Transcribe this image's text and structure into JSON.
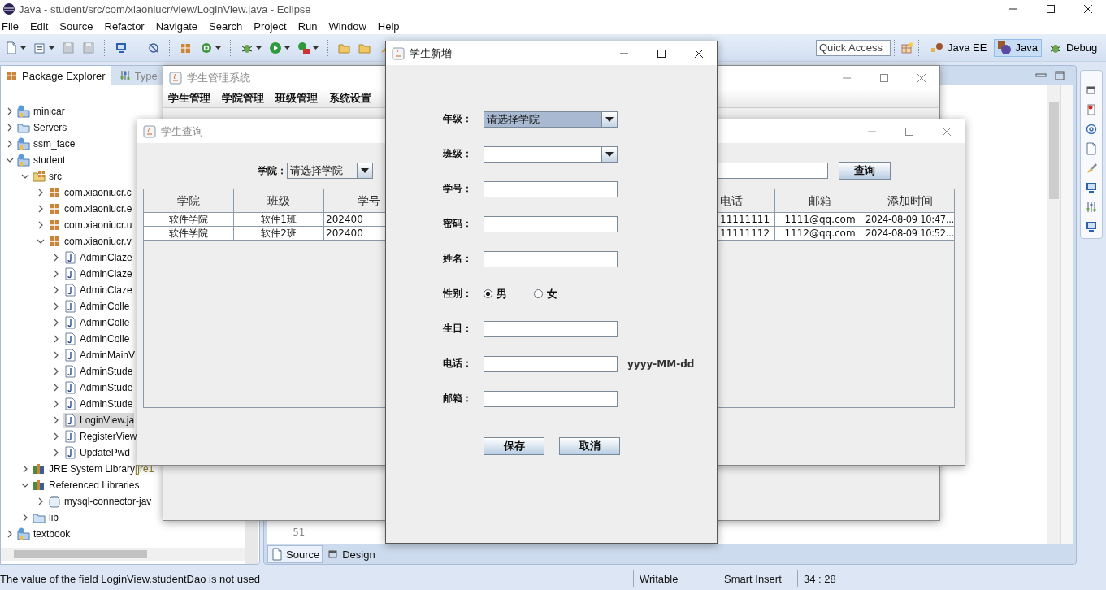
{
  "window": {
    "title": "Java - student/src/com/xiaoniucr/view/LoginView.java - Eclipse"
  },
  "menu": [
    "File",
    "Edit",
    "Source",
    "Refactor",
    "Navigate",
    "Search",
    "Project",
    "Run",
    "Window",
    "Help"
  ],
  "toolbar": {
    "quick_access": {
      "placeholder": "Quick Access"
    },
    "perspectives": [
      {
        "label": "Java EE",
        "selected": false
      },
      {
        "label": "Java",
        "selected": true
      },
      {
        "label": "Debug",
        "selected": false
      }
    ]
  },
  "views": {
    "tabs": [
      {
        "label": "Package Explorer",
        "selected": true
      },
      {
        "label": "Type",
        "selected": false
      }
    ],
    "tree": [
      {
        "label": "minicar",
        "kind": "project",
        "expanded": false,
        "selected": false
      },
      {
        "label": "Servers",
        "kind": "folder",
        "expanded": false,
        "selected": false
      },
      {
        "label": "ssm_face",
        "kind": "project",
        "expanded": false,
        "selected": false
      },
      {
        "label": "student",
        "kind": "project",
        "expanded": true,
        "selected": false,
        "children": [
          {
            "label": "src",
            "kind": "source-folder",
            "expanded": true,
            "selected": false,
            "children": [
              {
                "label": "com.xiaoniucr.c",
                "kind": "package",
                "expanded": false,
                "selected": false
              },
              {
                "label": "com.xiaoniucr.e",
                "kind": "package",
                "expanded": false,
                "selected": false
              },
              {
                "label": "com.xiaoniucr.u",
                "kind": "package",
                "expanded": false,
                "selected": false
              },
              {
                "label": "com.xiaoniucr.v",
                "kind": "package",
                "expanded": true,
                "selected": false,
                "children": [
                  {
                    "label": "AdminClaze",
                    "kind": "java-file",
                    "expanded": false,
                    "selected": false
                  },
                  {
                    "label": "AdminClaze",
                    "kind": "java-file",
                    "expanded": false,
                    "selected": false
                  },
                  {
                    "label": "AdminClaze",
                    "kind": "java-file",
                    "expanded": false,
                    "selected": false
                  },
                  {
                    "label": "AdminColle",
                    "kind": "java-file",
                    "expanded": false,
                    "selected": false
                  },
                  {
                    "label": "AdminColle",
                    "kind": "java-file",
                    "expanded": false,
                    "selected": false
                  },
                  {
                    "label": "AdminColle",
                    "kind": "java-file",
                    "expanded": false,
                    "selected": false
                  },
                  {
                    "label": "AdminMainV",
                    "kind": "java-file",
                    "expanded": false,
                    "selected": false
                  },
                  {
                    "label": "AdminStude",
                    "kind": "java-file",
                    "expanded": false,
                    "selected": false
                  },
                  {
                    "label": "AdminStude",
                    "kind": "java-file",
                    "expanded": false,
                    "selected": false
                  },
                  {
                    "label": "AdminStude",
                    "kind": "java-file",
                    "expanded": false,
                    "selected": false
                  },
                  {
                    "label": "LoginView.ja",
                    "kind": "java-file",
                    "expanded": false,
                    "selected": true
                  },
                  {
                    "label": "RegisterView",
                    "kind": "java-file",
                    "expanded": false,
                    "selected": false
                  },
                  {
                    "label": "UpdatePwd",
                    "kind": "java-file",
                    "expanded": false,
                    "selected": false
                  }
                ]
              }
            ]
          },
          {
            "label": "JRE System Library",
            "decoration": "[jre1",
            "kind": "library",
            "expanded": false,
            "selected": false
          },
          {
            "label": "Referenced Libraries",
            "kind": "library",
            "expanded": true,
            "selected": false,
            "children": [
              {
                "label": "mysql-connector-jav",
                "kind": "jar",
                "expanded": false,
                "selected": false
              }
            ]
          },
          {
            "label": "lib",
            "kind": "folder",
            "expanded": false,
            "selected": false
          }
        ]
      },
      {
        "label": "textbook",
        "kind": "project",
        "expanded": false,
        "selected": false
      }
    ]
  },
  "editor": {
    "line_number": "51",
    "tabs": [
      {
        "label": "Source",
        "selected": true
      },
      {
        "label": "Design",
        "selected": false
      }
    ]
  },
  "status_bar": {
    "message": "The value of the field LoginView.studentDao is not used",
    "mode": "Writable",
    "insert_mode": "Smart Insert",
    "position": "34 : 28"
  },
  "main_window": {
    "title": "学生管理系统",
    "menu": [
      "学生管理",
      "学院管理",
      "班级管理",
      "系统设置"
    ]
  },
  "query_window": {
    "title": "学生查询",
    "college_label": "学院：",
    "college_value": "请选择学院",
    "search_button": "查询",
    "table": {
      "columns": [
        "学院",
        "班级",
        "学号",
        "电话",
        "邮箱",
        "添加时间"
      ],
      "rows": [
        [
          "软件学院",
          "软件1班",
          "202400",
          "11111111",
          "1111@qq.com",
          "2024-08-09 10:47..."
        ],
        [
          "软件学院",
          "软件2班",
          "202400",
          "11111112",
          "1112@qq.com",
          "2024-08-09 10:52..."
        ]
      ]
    }
  },
  "dialog": {
    "title": "学生新增",
    "fields": [
      {
        "kind": "combo",
        "label": "年级：",
        "value": "请选择学院",
        "focused": true
      },
      {
        "kind": "combo",
        "label": "班级：",
        "focused": false
      },
      {
        "kind": "text",
        "label": "学号："
      },
      {
        "kind": "text",
        "label": "密码："
      },
      {
        "kind": "text",
        "label": "姓名："
      },
      {
        "kind": "radio",
        "label": "性别：",
        "options": [
          {
            "label": "男",
            "selected": true
          },
          {
            "label": "女",
            "selected": false
          }
        ]
      },
      {
        "kind": "text",
        "label": "生日："
      },
      {
        "kind": "text",
        "label": "电话：",
        "note": "yyyy-MM-dd"
      },
      {
        "kind": "text",
        "label": "邮箱："
      }
    ],
    "buttons": [
      "保存",
      "取消"
    ]
  }
}
